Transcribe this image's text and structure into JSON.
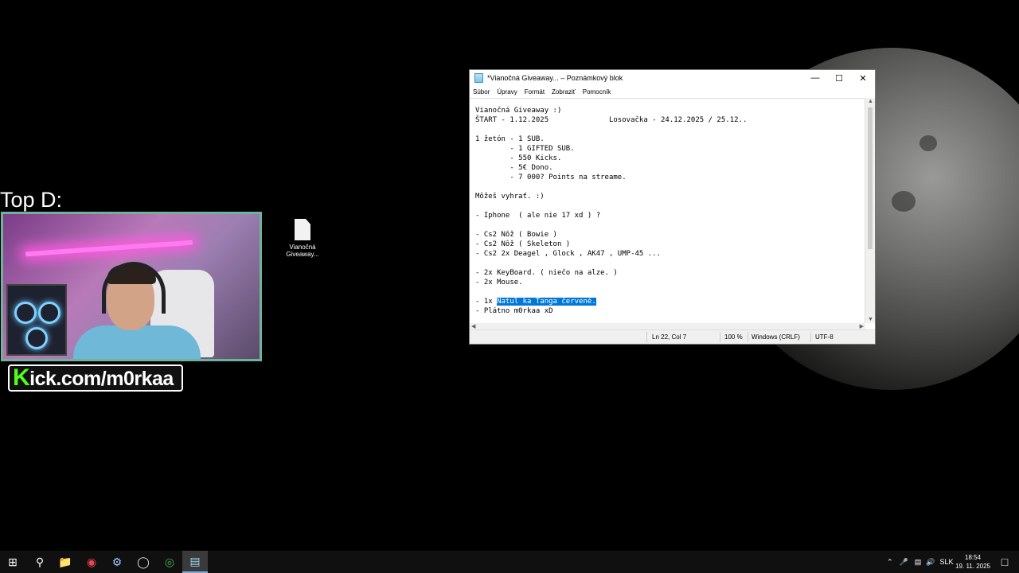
{
  "overlay": {
    "top_title": "Top D:",
    "kick_k": "K",
    "kick_rest": "ick.com/m0rkaa"
  },
  "desktop_icon": {
    "label_line1": "Vianočná",
    "label_line2": "Giveaway..."
  },
  "notepad": {
    "title": "*Vianočná Giveaway... – Poznámkový blok",
    "menu": [
      "Súbor",
      "Úpravy",
      "Formát",
      "Zobraziť",
      "Pomocník"
    ],
    "lines": [
      "Vianočná Giveaway :)",
      "ŠTART - 1.12.2025              Losovačka - 24.12.2025 / 25.12..",
      "",
      "1 žetón - 1 SUB.",
      "        - 1 GIFTED SUB.",
      "        - 550 Kicks.",
      "        - 5€ Dono.",
      "        - 7 000? Points na streame.",
      "",
      "Môžeš vyhrať. :)",
      "",
      "- Iphone  ( ale nie 17 xd ) ?",
      "",
      "- Cs2 Nôž ( Bowie )",
      "- Cs2 Nôž ( Skeleton )",
      "- Cs2 2x Deagel , Glock , AK47 , UMP-45 ...",
      "",
      "- 2x KeyBoard. ( niečo na alze. )",
      "- 2x Mouse.",
      ""
    ],
    "selected_line_prefix": "- 1x ",
    "selected_text": "Natul ka Tanga červené.",
    "last_line": "- Plátno m0rkaa xD",
    "status": {
      "position": "Ln 22, Col 7",
      "zoom": "100 %",
      "line_ending": "Windows (CRLF)",
      "encoding": "UTF-8"
    }
  },
  "taskbar": {
    "language": "SLK",
    "time": "18:54",
    "date": "19. 11. 2025",
    "apps": [
      "start-icon",
      "search-icon",
      "file-explorer-icon",
      "browser-icon",
      "steam-icon",
      "obs-icon",
      "chrome-icon",
      "notepad-icon"
    ]
  }
}
